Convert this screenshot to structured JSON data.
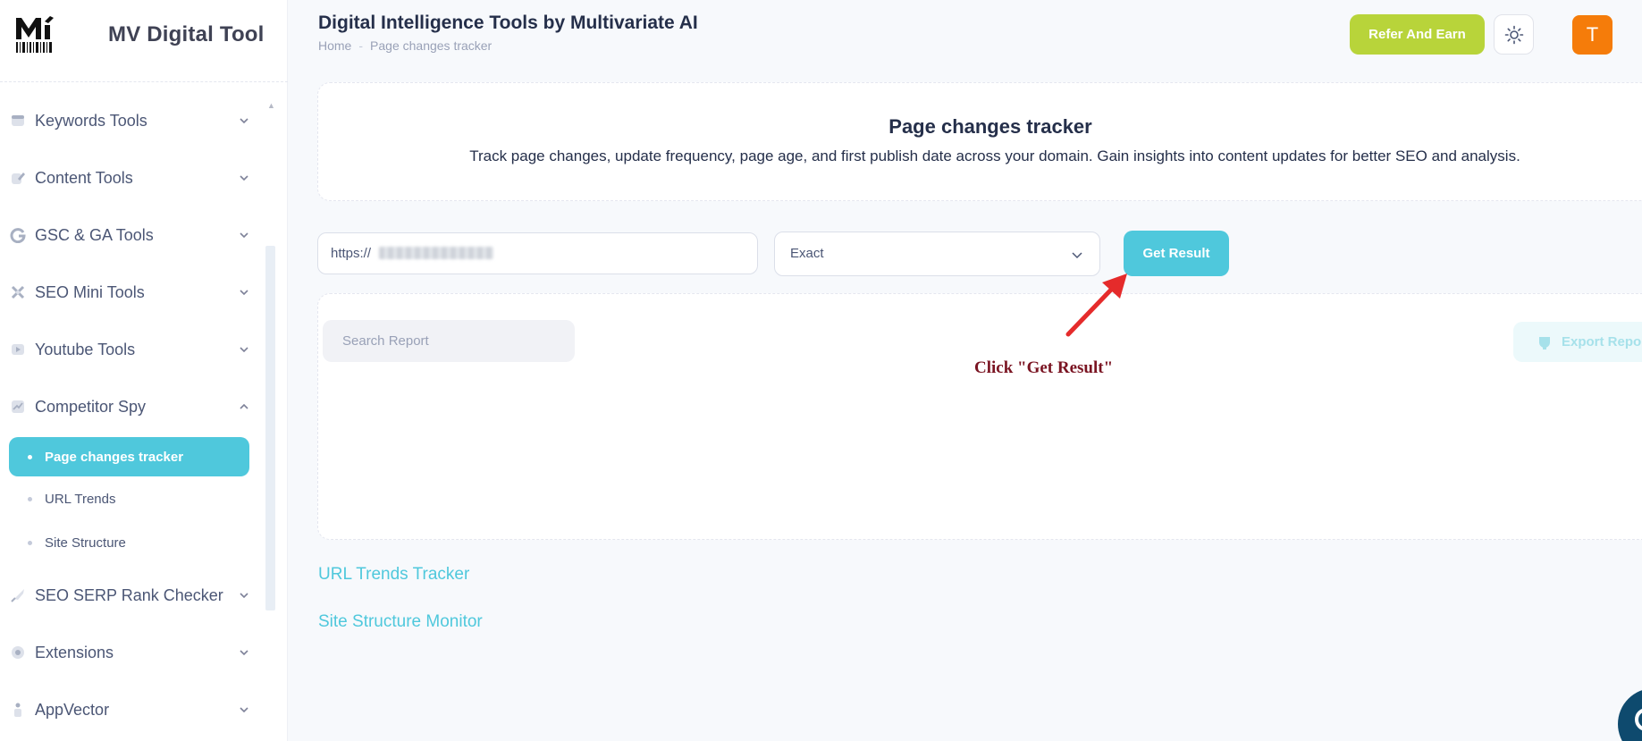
{
  "brand": {
    "name": "MV Digital Tool"
  },
  "header": {
    "title": "Digital Intelligence Tools by Multivariate AI",
    "breadcrumb": {
      "home": "Home",
      "separator": "-",
      "current": "Page changes tracker"
    },
    "refer_label": "Refer And Earn",
    "avatar_initial": "T"
  },
  "sidebar": {
    "groups": [
      {
        "label": "Keywords Tools"
      },
      {
        "label": "Content Tools"
      },
      {
        "label": "GSC & GA Tools"
      },
      {
        "label": "SEO Mini Tools"
      },
      {
        "label": "Youtube Tools"
      },
      {
        "label": "Competitor Spy"
      },
      {
        "label": "SEO SERP Rank Checker"
      },
      {
        "label": "Extensions"
      },
      {
        "label": "AppVector"
      }
    ],
    "competitor_spy_items": [
      {
        "label": "Page changes tracker",
        "active": true
      },
      {
        "label": "URL Trends",
        "active": false
      },
      {
        "label": "Site Structure",
        "active": false
      }
    ]
  },
  "intro": {
    "title": "Page changes tracker",
    "description": "Track page changes, update frequency, page age, and first publish date across your domain. Gain insights into content updates for better SEO and analysis."
  },
  "controls": {
    "url_value": "https://",
    "match_value": "Exact",
    "get_result_label": "Get Result"
  },
  "report": {
    "search_placeholder": "Search Report",
    "export_label": "Export Report"
  },
  "annotation": {
    "text": "Click \"Get Result\""
  },
  "links": {
    "url_trends": "URL Trends Tracker",
    "site_structure": "Site Structure Monitor"
  },
  "colors": {
    "accent": "#4fc8dc",
    "refer": "#b8d43a",
    "avatar": "#f57c0a",
    "annotation": "#7a1422",
    "arrow": "#e52b2b"
  }
}
